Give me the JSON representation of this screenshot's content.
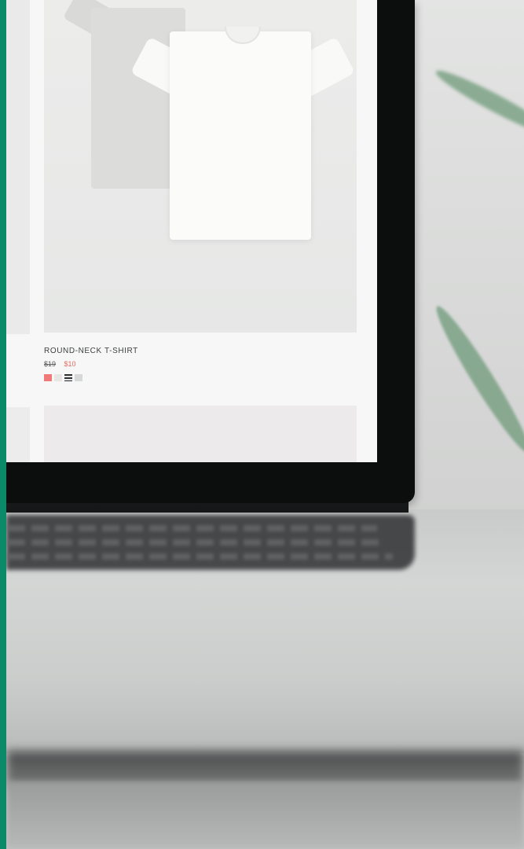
{
  "colors": {
    "accent_bar": "#0a8a68",
    "sale_price": "#e26a5f",
    "swatch_colors": [
      "#f07a7a",
      "#e8e6e4",
      "stripe",
      "#d7d8d8"
    ]
  },
  "product": {
    "name": "ROUND-NECK T-SHIRT",
    "price_original": "$19",
    "price_sale": "$10"
  }
}
